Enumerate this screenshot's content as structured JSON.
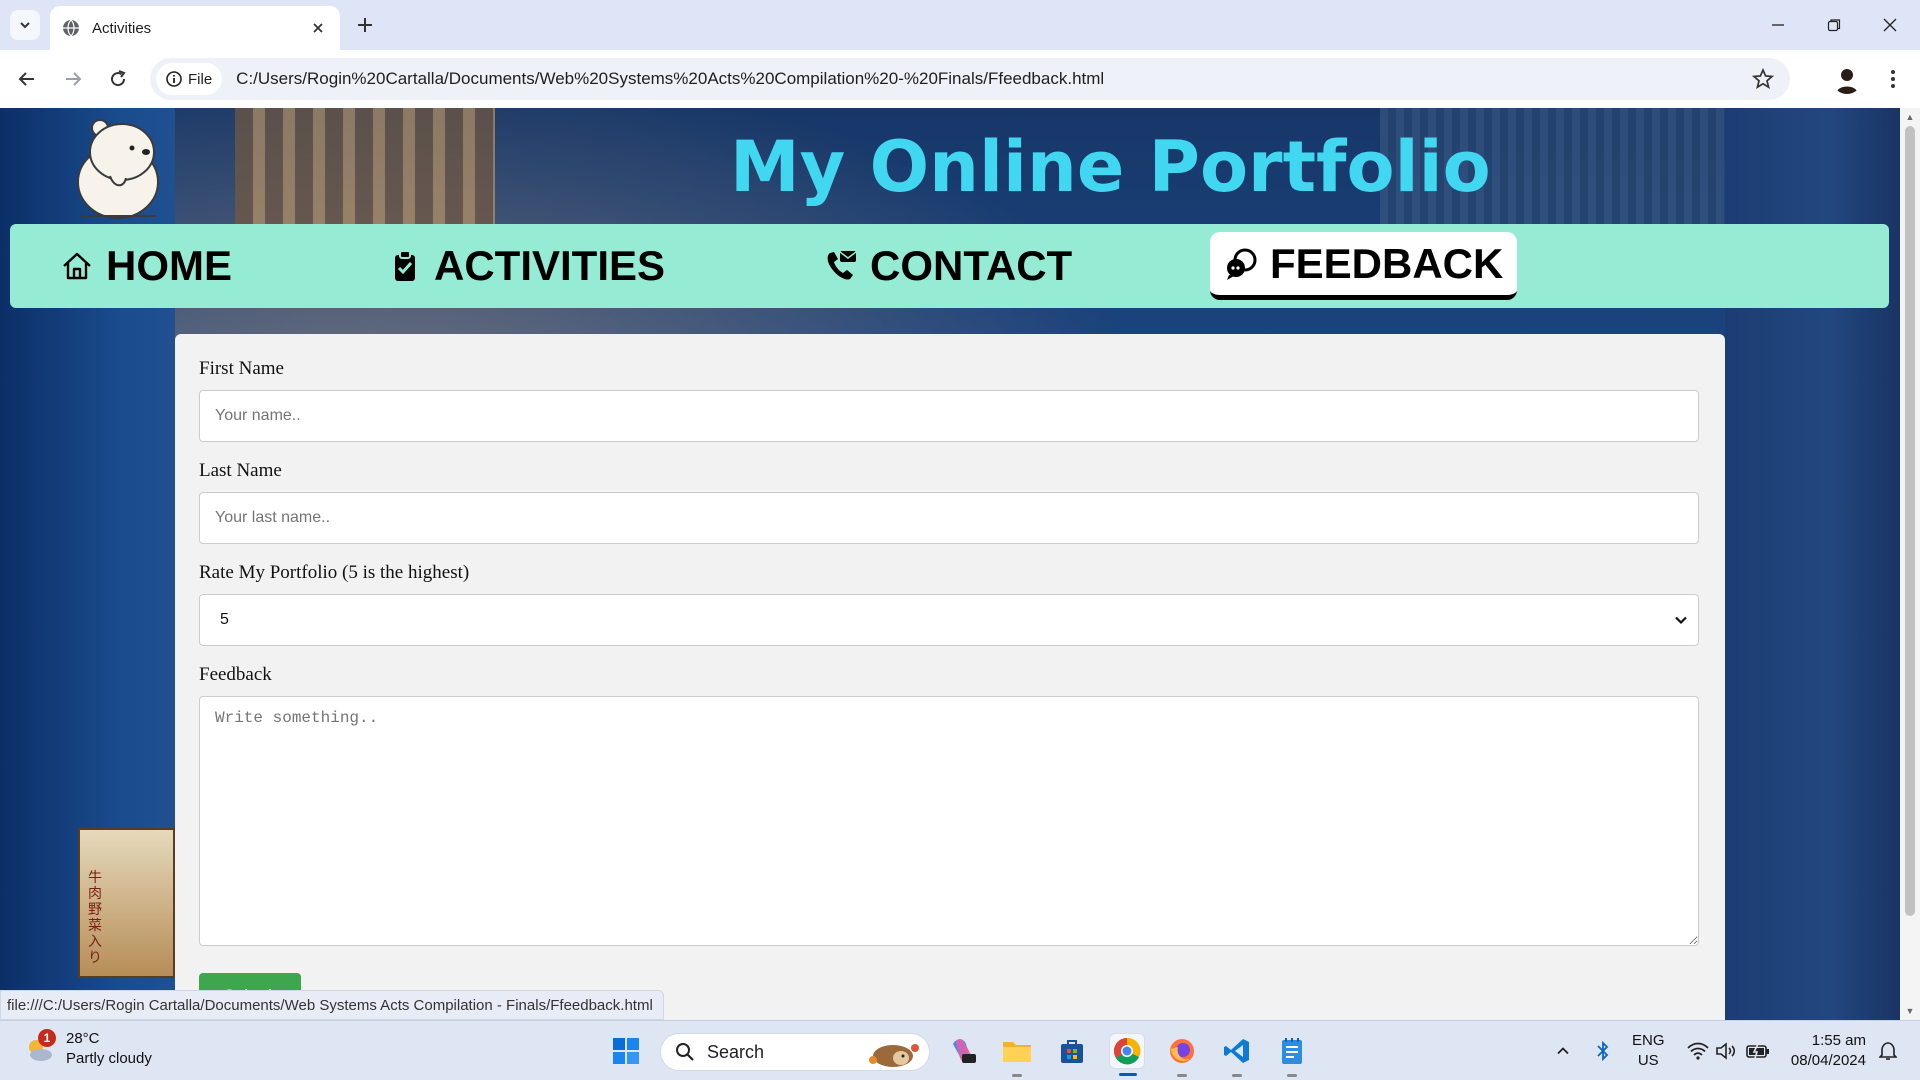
{
  "browser": {
    "tab_title": "Activities",
    "url_chip": "File",
    "url": "C:/Users/Rogin%20Cartalla/Documents/Web%20Systems%20Acts%20Compilation%20-%20Finals/Ffeedback.html",
    "status_url": "file:///C:/Users/Rogin Cartalla/Documents/Web Systems Acts Compilation - Finals/Ffeedback.html"
  },
  "site": {
    "title": "My Online Portfolio",
    "poster_text": "牛肉野菜入り"
  },
  "nav": {
    "items": [
      {
        "label": "HOME",
        "icon": "home-icon"
      },
      {
        "label": "ACTIVITIES",
        "icon": "clipboard-check-icon"
      },
      {
        "label": "CONTACT",
        "icon": "phone-mail-icon"
      },
      {
        "label": "FEEDBACK",
        "icon": "feedback-chat-icon"
      }
    ],
    "active": "FEEDBACK"
  },
  "form": {
    "first_name_label": "First Name",
    "first_name_placeholder": "Your name..",
    "last_name_label": "Last Name",
    "last_name_placeholder": "Your last name..",
    "rating_label": "Rate My Portfolio (5 is the highest)",
    "rating_value": "5",
    "feedback_label": "Feedback",
    "feedback_placeholder": "Write something..",
    "submit_label": "Submit"
  },
  "taskbar": {
    "weather_temp": "28°C",
    "weather_desc": "Partly cloudy",
    "weather_badge": "1",
    "search_label": "Search",
    "lang_1": "ENG",
    "lang_2": "US",
    "time": "1:55 am",
    "date": "08/04/2024"
  },
  "colors": {
    "title": "#41d7f0",
    "navbar": "#96ebd5",
    "submit": "#3fa650"
  }
}
